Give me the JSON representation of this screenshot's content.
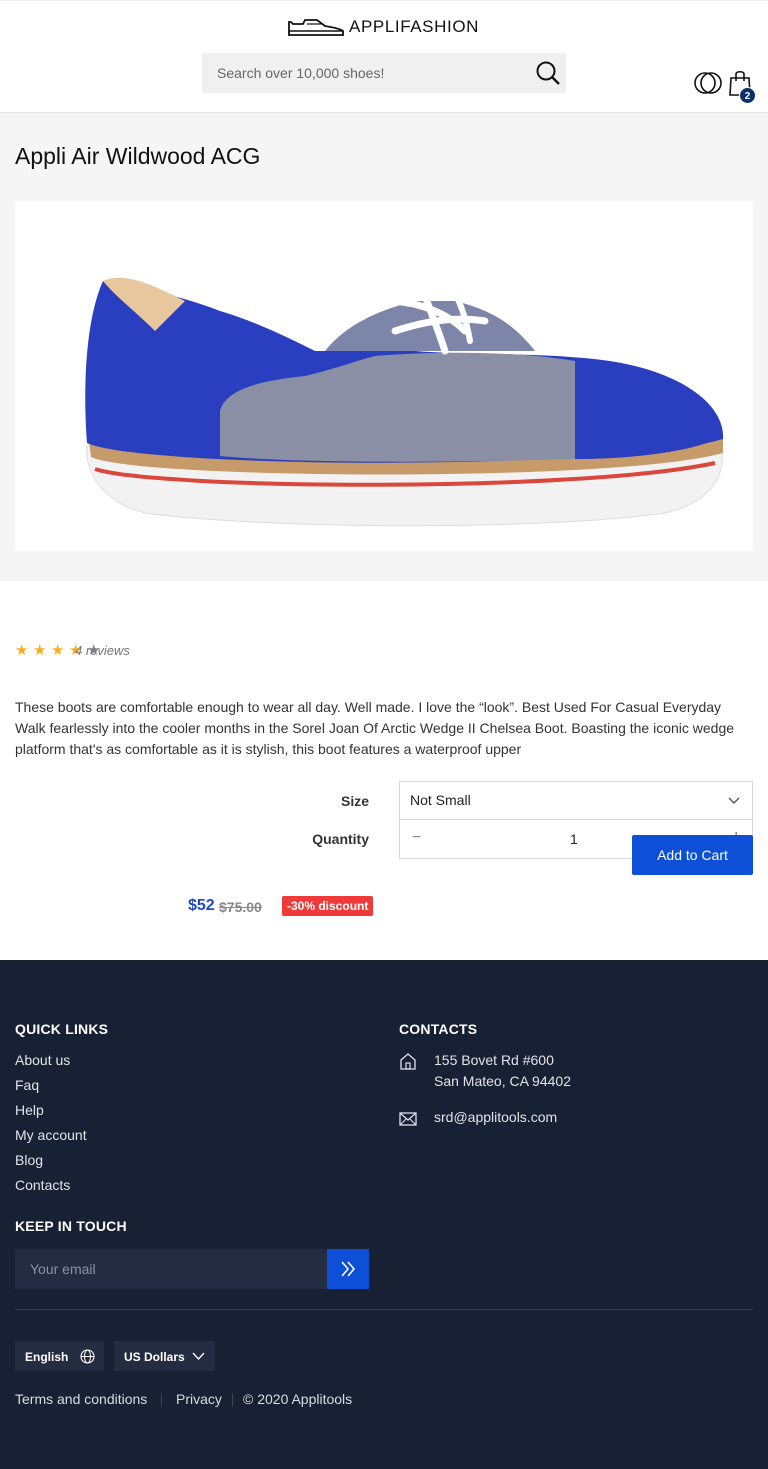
{
  "header": {
    "logo_text": "APPLIFASHION",
    "search_placeholder": "Search over 10,000 shoes!",
    "cart_count": "2"
  },
  "product": {
    "title": "Appli Air Wildwood ACG",
    "rating": 3.5,
    "reviews_label": "4 reviews",
    "description": "These boots are comfortable enough to wear all day. Well made. I love the “look”. Best Used For Casual Everyday Walk fearlessly into the cooler months in the Sorel Joan Of Arctic Wedge II Chelsea Boot. Boasting the iconic wedge platform that's as comfortable as it is stylish, this boot features a waterproof upper",
    "size_label": "Size",
    "size_value": "Not Small",
    "quantity_label": "Quantity",
    "quantity_value": "1",
    "quantity_minus": "−",
    "quantity_plus": "+",
    "add_to_cart_label": "Add to Cart",
    "price": "$52",
    "old_price": "$75.00",
    "discount": "-30% discount"
  },
  "footer": {
    "quick_links_heading": "QUICK LINKS",
    "quick_links": [
      "About us",
      "Faq",
      "Help",
      "My account",
      "Blog",
      "Contacts"
    ],
    "contacts_heading": "CONTACTS",
    "address_line1": "155 Bovet Rd #600",
    "address_line2": "San Mateo, CA 94402",
    "email": "srd@applitools.com",
    "keep_in_touch_heading": "KEEP IN TOUCH",
    "email_placeholder": "Your email",
    "language": "English",
    "currency": "US Dollars",
    "terms": "Terms and conditions",
    "privacy": "Privacy",
    "copyright": "© 2020 Applitools"
  },
  "colors": {
    "accent": "#0d4fd6",
    "price": "#1e49c6",
    "discount": "#f03a3a",
    "footer_bg": "#182033",
    "star": "#f6b01e"
  },
  "icons": {
    "logo": "shoe-icon",
    "search": "search-icon",
    "user": "user-icon",
    "cart": "shopping-bag-icon",
    "select": "chevron-down-icon",
    "address": "home-icon",
    "email": "envelope-icon",
    "subscribe": "double-chevron-right-icon",
    "language": "globe-icon",
    "currency": "chevron-down-icon"
  }
}
